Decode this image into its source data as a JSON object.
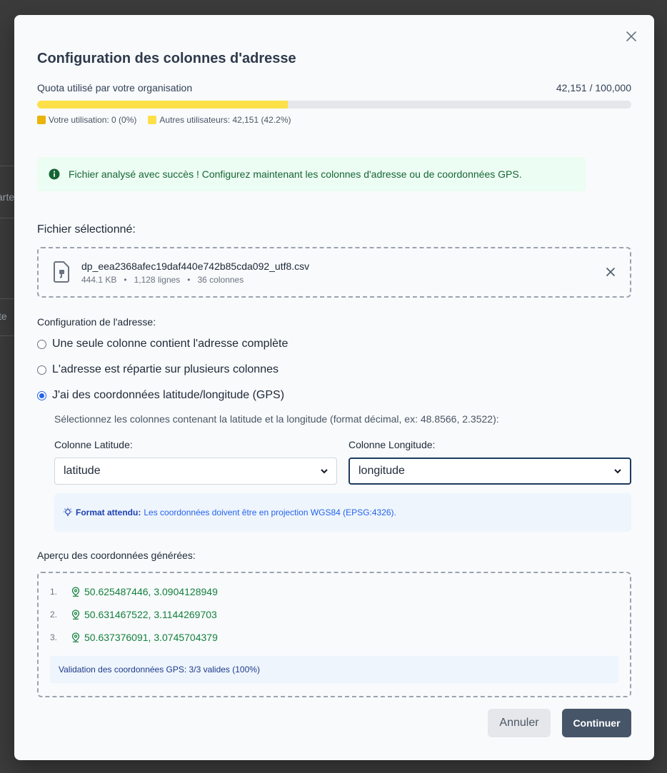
{
  "background": {
    "fragment_1": "arte",
    "fragment_2": "te"
  },
  "modal": {
    "title": "Configuration des colonnes d'adresse",
    "quota": {
      "label": "Quota utilisé par votre organisation",
      "value_text": "42,151 / 100,000",
      "used": 42151,
      "total": 100000,
      "fill_fraction": 0.4215,
      "legend_own": "Votre utilisation: 0 (0%)",
      "legend_others": "Autres utilisateurs: 42,151 (42.2%)",
      "own_color": "#eab308",
      "others_color": "#fde047"
    },
    "alert": {
      "icon": "info-icon",
      "text": "Fichier analysé avec succès ! Configurez maintenant les colonnes d'adresse ou de coordonnées GPS."
    },
    "file": {
      "section_label": "Fichier sélectionné:",
      "name": "dp_eea2368afec19daf440e742b85cda092_utf8.csv",
      "size": "444.1 KB",
      "rows": "1,128 lignes",
      "cols": "36 colonnes",
      "separator": "•"
    },
    "address_config": {
      "label": "Configuration de l'adresse:",
      "options": [
        {
          "label": "Une seule colonne contient l'adresse complète",
          "checked": false
        },
        {
          "label": "L'adresse est répartie sur plusieurs colonnes",
          "checked": false
        },
        {
          "label": "J'ai des coordonnées latitude/longitude (GPS)",
          "checked": true
        }
      ],
      "hint": "Sélectionnez les colonnes contenant la latitude et la longitude (format décimal, ex: 48.8566, 2.3522):",
      "lat_label": "Colonne Latitude:",
      "lat_value": "latitude",
      "lon_label": "Colonne Longitude:",
      "lon_value": "longitude",
      "format_title": "Format attendu:",
      "format_text": "Les coordonnées doivent être en projection WGS84 (EPSG:4326)."
    },
    "preview": {
      "label": "Aperçu des coordonnées générées:",
      "items": [
        {
          "num": "1.",
          "coords": "50.625487446, 3.0904128949"
        },
        {
          "num": "2.",
          "coords": "50.631467522, 3.1144269703"
        },
        {
          "num": "3.",
          "coords": "50.637376091, 3.0745704379"
        }
      ],
      "validation": "Validation des coordonnées GPS: 3/3 valides (100%)"
    },
    "buttons": {
      "cancel": "Annuler",
      "continue": "Continuer"
    }
  }
}
